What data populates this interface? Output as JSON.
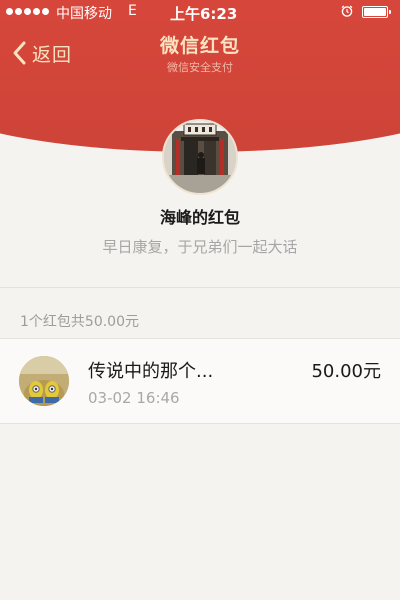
{
  "status_bar": {
    "carrier": "中国移动",
    "network": "E",
    "time": "上午6:23",
    "icons": [
      "signal-dots-icon",
      "alarm-icon",
      "battery-icon"
    ]
  },
  "nav": {
    "back_label": "返回",
    "title": "微信红包",
    "subtitle": "微信安全支付"
  },
  "sender": {
    "name": "海峰的红包",
    "blessing": "早日康复，于兄弟们一起大话"
  },
  "summary": "1个红包共50.00元",
  "records": [
    {
      "name": "传说中的那个...",
      "time": "03-02 16:46",
      "amount": "50.00元"
    }
  ],
  "colors": {
    "header_red": "#d9473b",
    "header_text": "#fbe3c2",
    "background": "#f5f3ef"
  }
}
